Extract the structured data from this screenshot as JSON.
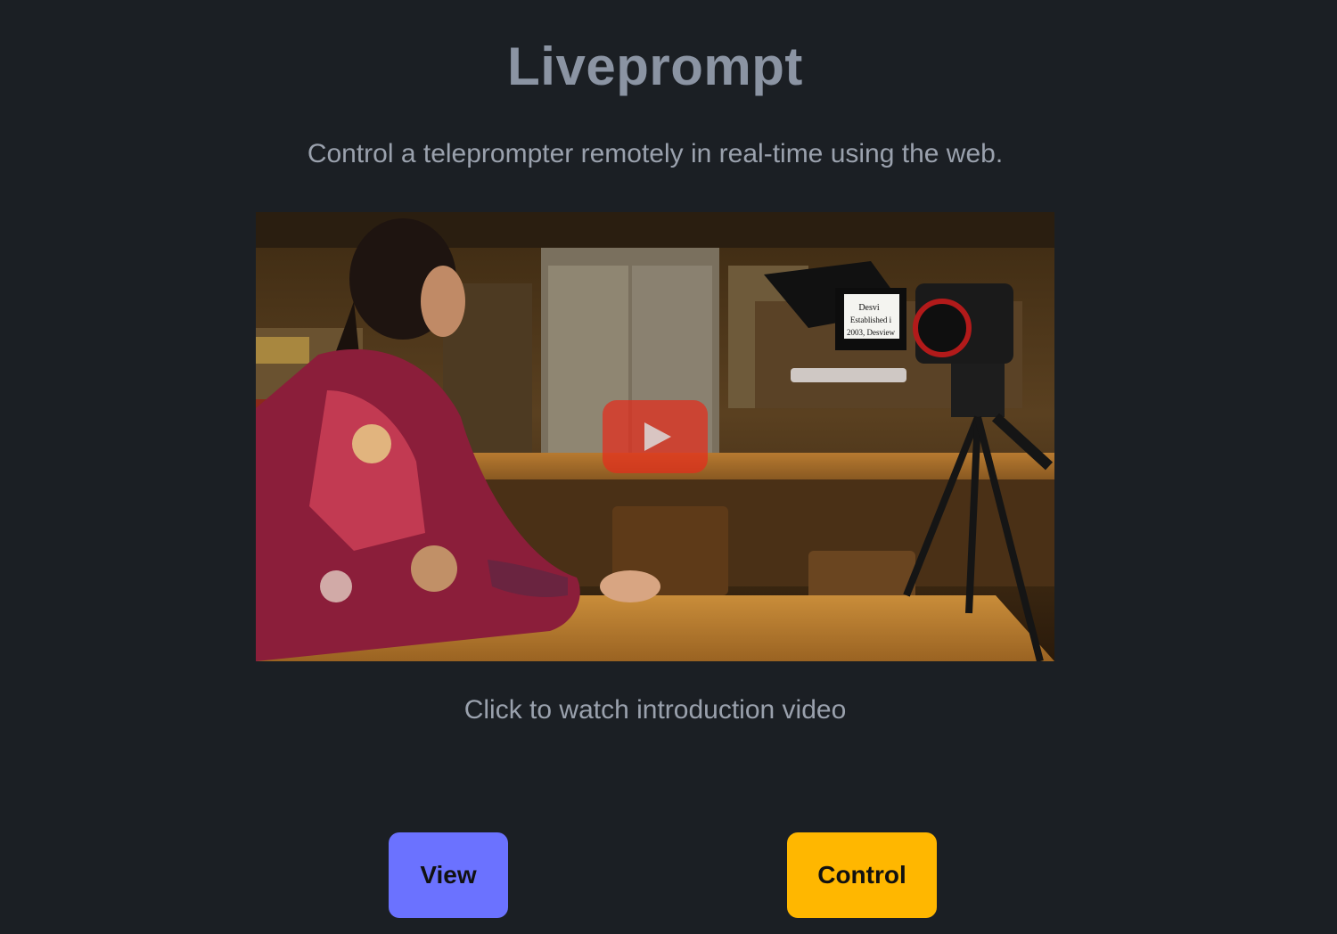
{
  "app": {
    "title": "Liveprompt",
    "tagline": "Control a teleprompter remotely in real-time using the web."
  },
  "video": {
    "caption": "Click to watch introduction video",
    "play_icon": "play-icon",
    "thumbnail_text": [
      "Desvi",
      "Established i",
      "2003, Desview"
    ],
    "play_color": "#e42c1c"
  },
  "actions": {
    "view_label": "View",
    "control_label": "Control",
    "view_color": "#6b72ff",
    "control_color": "#ffb700"
  },
  "theme": {
    "background": "#1b1f24",
    "title_color": "#8b94a3",
    "text_color": "#9aa1ad"
  }
}
